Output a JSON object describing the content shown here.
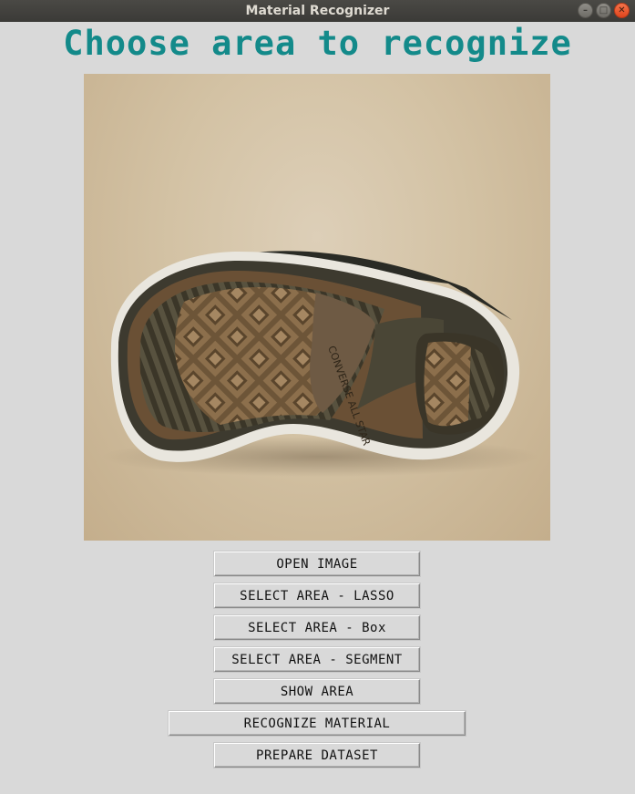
{
  "window": {
    "title": "Material Recognizer",
    "controls": [
      "minimize",
      "maximize",
      "close"
    ]
  },
  "heading": "Choose area to recognize",
  "colors": {
    "heading": "#138a8a",
    "background": "#d9d9d9",
    "titlebar": "#3b3a37",
    "close_button": "#e0451d"
  },
  "image": {
    "description_icon": "sneaker-sole-photo",
    "sole_text": "CONVERSE ALL STAR"
  },
  "buttons": {
    "open_image": "OPEN IMAGE",
    "select_lasso": "SELECT AREA - LASSO",
    "select_box": "SELECT AREA - Box",
    "select_segment": "SELECT AREA - SEGMENT",
    "show_area": "SHOW AREA",
    "recognize": "RECOGNIZE MATERIAL",
    "prepare_dataset": "PREPARE DATASET"
  }
}
